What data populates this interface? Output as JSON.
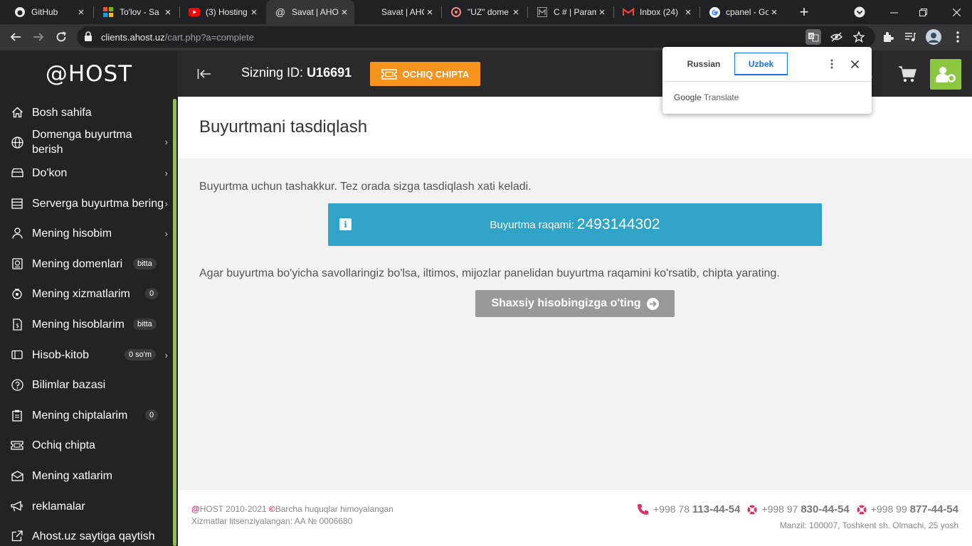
{
  "browser": {
    "tabs": [
      {
        "title": "GitHub",
        "icon": "github-icon"
      },
      {
        "title": "To'lov - Sa",
        "icon": "microsoft-icon"
      },
      {
        "title": "(3) Hosting",
        "icon": "youtube-icon"
      },
      {
        "title": "Savat | AHO",
        "icon": "at-icon",
        "active": true
      },
      {
        "title": "Savat | AHO",
        "icon": "none"
      },
      {
        "title": "\"UZ\" dome",
        "icon": "globe-icon"
      },
      {
        "title": "C # | Param",
        "icon": "m-icon"
      },
      {
        "title": "Inbox (24)",
        "icon": "gmail-icon"
      },
      {
        "title": "cpanel - Go",
        "icon": "google-icon"
      }
    ],
    "address_host": "clients.ahost.uz",
    "address_path": "/cart.php?a=complete"
  },
  "translate": {
    "tab_from": "Russian",
    "tab_to": "Uzbek",
    "brand_google": "Google",
    "brand_translate": "Translate"
  },
  "sidebar": {
    "logo": "@HOST",
    "items": [
      {
        "label": "Bosh sahifa",
        "icon": "home-icon"
      },
      {
        "label": "Domenga buyurtma",
        "label2": "berish",
        "icon": "globe-icon",
        "chevron": true
      },
      {
        "label": "Do'kon",
        "icon": "box-icon",
        "chevron": true
      },
      {
        "label": "Serverga buyurtma bering",
        "icon": "server-icon",
        "chevron": true
      },
      {
        "label": "Mening hisobim",
        "icon": "user-icon",
        "chevron": true
      },
      {
        "label": "Mening domenlari",
        "icon": "domain-icon",
        "badge": "bitta"
      },
      {
        "label": "Mening xizmatlarim",
        "icon": "services-icon",
        "badge": "0"
      },
      {
        "label": "Mening hisoblarim",
        "icon": "invoice-icon",
        "badge": "bitta"
      },
      {
        "label": "Hisob-kitob",
        "icon": "wallet-icon",
        "badge": "0 so'm",
        "chevron": true
      },
      {
        "label": "Bilimlar bazasi",
        "icon": "question-icon"
      },
      {
        "label": "Mening chiptalarim",
        "icon": "clipboard-icon",
        "badge": "0"
      },
      {
        "label": "Ochiq chipta",
        "icon": "ticket-icon"
      },
      {
        "label": "Mening xatlarim",
        "icon": "mail-icon"
      },
      {
        "label": "reklamalar",
        "icon": "megaphone-icon"
      },
      {
        "label": "Ahost.uz saytiga qaytish",
        "icon": "external-link-icon"
      }
    ]
  },
  "header": {
    "id_label": "Sizning ID:",
    "id_value": "U16691",
    "open_ticket": "OCHIQ CHIPTA"
  },
  "main": {
    "page_title": "Buyurtmani tasdiqlash",
    "thanks": "Buyurtma uchun tashakkur. Tez orada sizga tasdiqlash xati keladi.",
    "order_label": "Buyurtma raqami:",
    "order_number": "2493144302",
    "questions": "Agar buyurtma bo'yicha savollaringiz bo'lsa, iltimos, mijozlar panelidan buyurtma raqamini ko'rsatib, chipta yarating.",
    "go_account": "Shaxsiy hisobingizga o'ting"
  },
  "footer": {
    "brand": "@",
    "copyright_text": "HOST 2010-2021",
    "copyright_mark": "©",
    "rights": "Barcha huquqlar himoyalangan",
    "license": "Xizmatlar litsenziyalangan: AA № 0006680",
    "phones": [
      {
        "prefix": "+998 78",
        "number": "113-44-54"
      },
      {
        "prefix": "+998 97",
        "number": "830-44-54"
      },
      {
        "prefix": "+998 99",
        "number": "877-44-54"
      }
    ],
    "address": "Manzil: 100007, Toshkent sh. Olmachi, 25 yosh"
  },
  "colors": {
    "accent_orange": "#f7941d",
    "accent_green": "#8dc63f",
    "info_blue": "#2fa4c7",
    "brand_pink": "#d6336c"
  }
}
